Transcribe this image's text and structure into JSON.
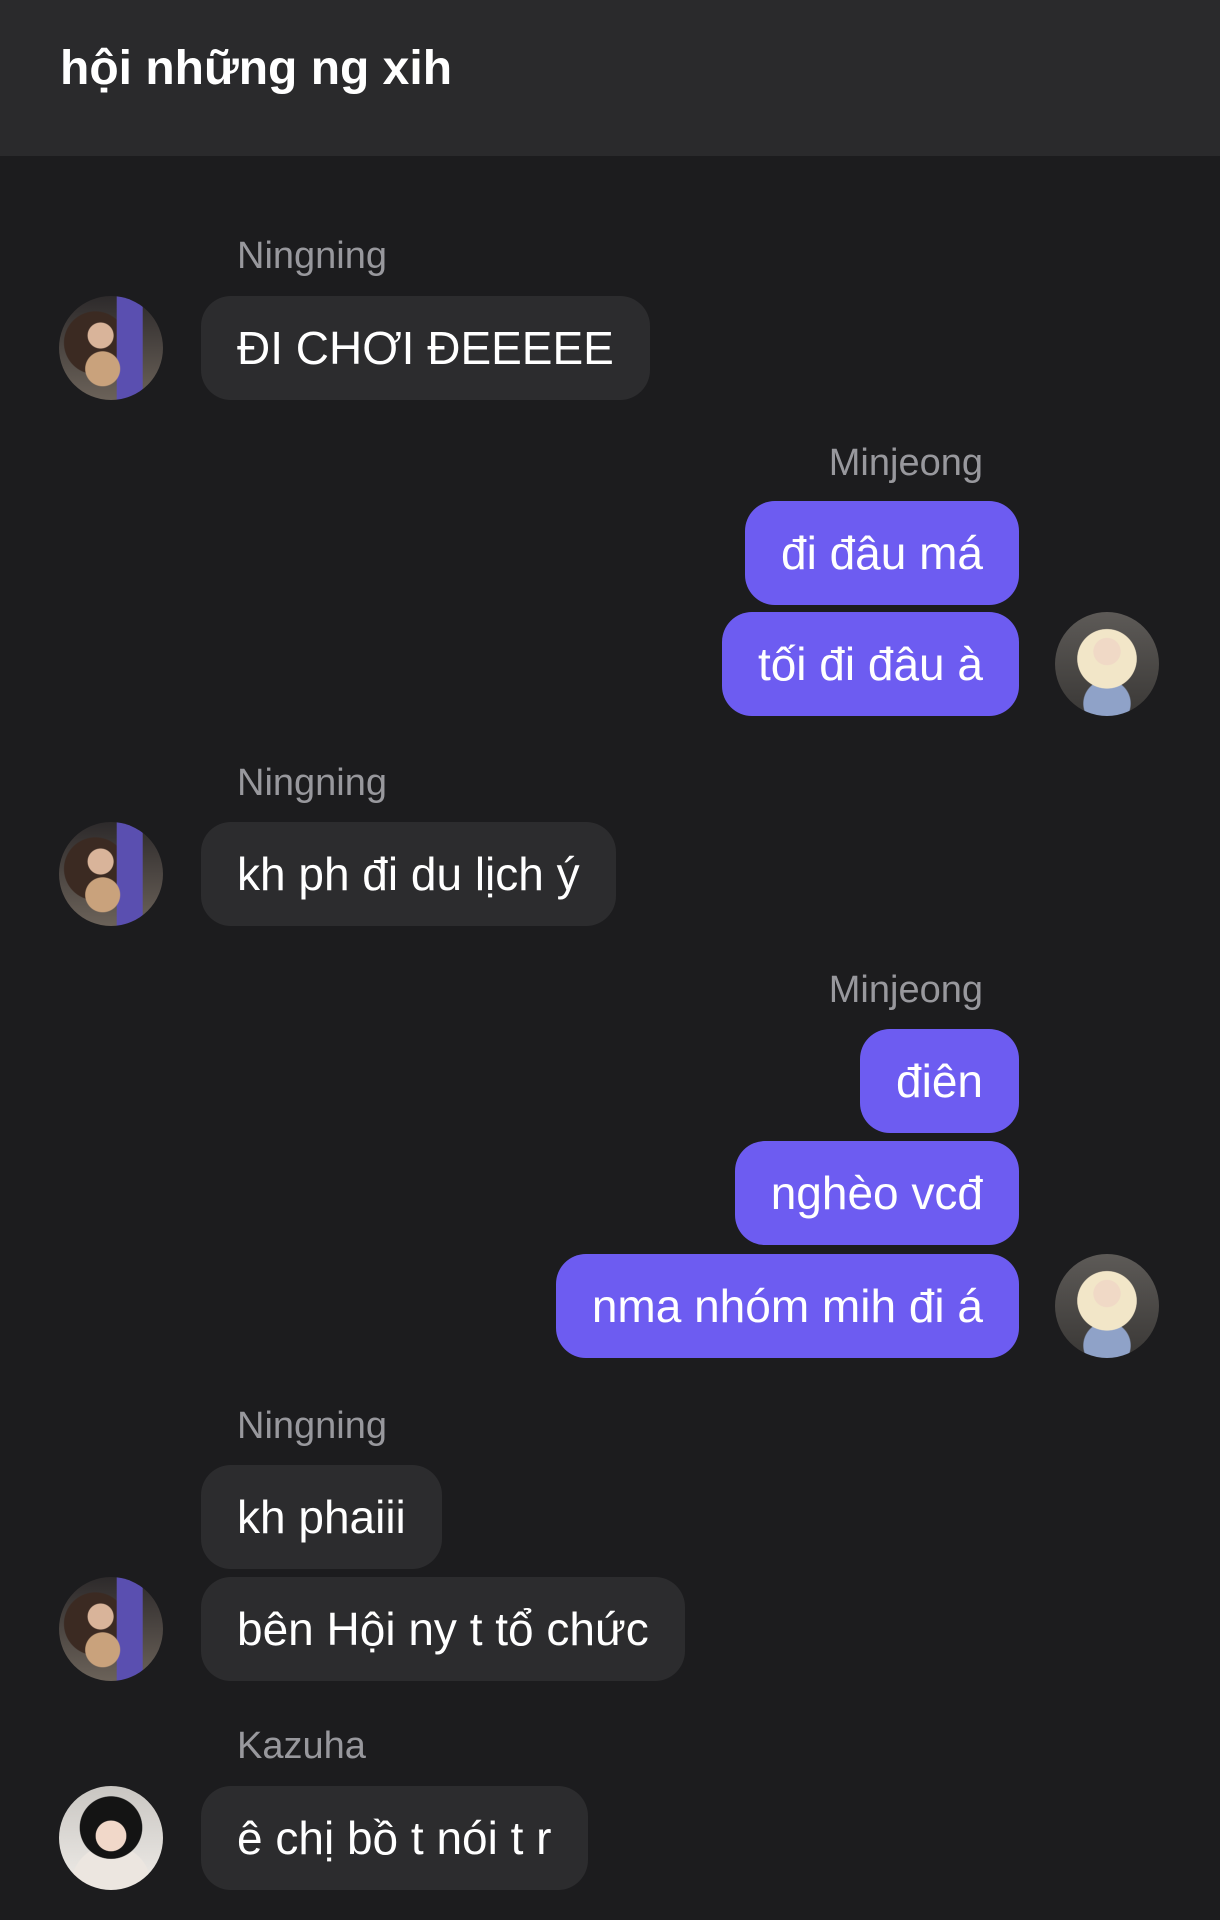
{
  "header": {
    "title": "hội những ng xih"
  },
  "users": {
    "ningning": {
      "name": "Ningning",
      "avatar_icon": "avatar-ningning"
    },
    "minjeong": {
      "name": "Minjeong",
      "avatar_icon": "avatar-minjeong"
    },
    "kazuha": {
      "name": "Kazuha",
      "avatar_icon": "avatar-kazuha"
    }
  },
  "messages": [
    {
      "sender": "Ningning",
      "direction": "incoming",
      "text": "ĐI CHƠI ĐEEEEE"
    },
    {
      "sender": "Minjeong",
      "direction": "outgoing",
      "text": "đi đâu má"
    },
    {
      "sender": "Minjeong",
      "direction": "outgoing",
      "text": "tối đi đâu à"
    },
    {
      "sender": "Ningning",
      "direction": "incoming",
      "text": "kh ph đi du lịch ý"
    },
    {
      "sender": "Minjeong",
      "direction": "outgoing",
      "text": "điên"
    },
    {
      "sender": "Minjeong",
      "direction": "outgoing",
      "text": "nghèo vcđ"
    },
    {
      "sender": "Minjeong",
      "direction": "outgoing",
      "text": "nma nhóm mih đi á"
    },
    {
      "sender": "Ningning",
      "direction": "incoming",
      "text": "kh phaiii"
    },
    {
      "sender": "Ningning",
      "direction": "incoming",
      "text": "bên Hội ny t tổ chức"
    },
    {
      "sender": "Kazuha",
      "direction": "incoming",
      "text": "ê chị bồ t nói t r"
    }
  ],
  "colors": {
    "background": "#1c1c1e",
    "header_bg": "#2a2a2c",
    "incoming_bubble": "#2c2c2e",
    "outgoing_bubble": "#6d5cf1",
    "sender_text": "#98989d"
  }
}
